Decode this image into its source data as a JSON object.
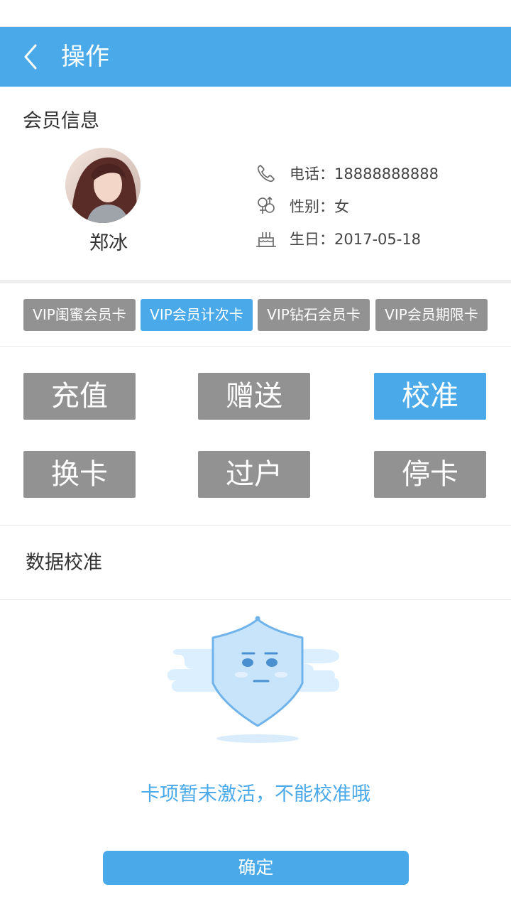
{
  "header": {
    "title": "操作",
    "back_icon": "chevron-left-icon"
  },
  "member": {
    "section_title": "会员信息",
    "name": "郑冰",
    "phone": "电话：18888888888",
    "gender": "性别：女",
    "birthday": "生日：2017-05-18",
    "icons": [
      "phone-icon",
      "gender-icon",
      "cake-icon"
    ]
  },
  "cards": [
    {
      "label": "VIP闺蜜会员卡",
      "active": false
    },
    {
      "label": "VIP会员计次卡",
      "active": true
    },
    {
      "label": "VIP钻石会员卡",
      "active": false
    },
    {
      "label": "VIP会员期限卡",
      "active": false
    }
  ],
  "actions": [
    {
      "label": "充值",
      "active": false
    },
    {
      "label": "赠送",
      "active": false
    },
    {
      "label": "校准",
      "active": true
    },
    {
      "label": "换卡",
      "active": false
    },
    {
      "label": "过户",
      "active": false
    },
    {
      "label": "停卡",
      "active": false
    }
  ],
  "data_section": {
    "title": "数据校准",
    "illustration": "shield-mascot-icon",
    "message": "卡项暂未激活，不能校准哦"
  },
  "confirm_label": "确定",
  "colors": {
    "accent": "#4aa9e9",
    "inactive_button": "#929292"
  }
}
